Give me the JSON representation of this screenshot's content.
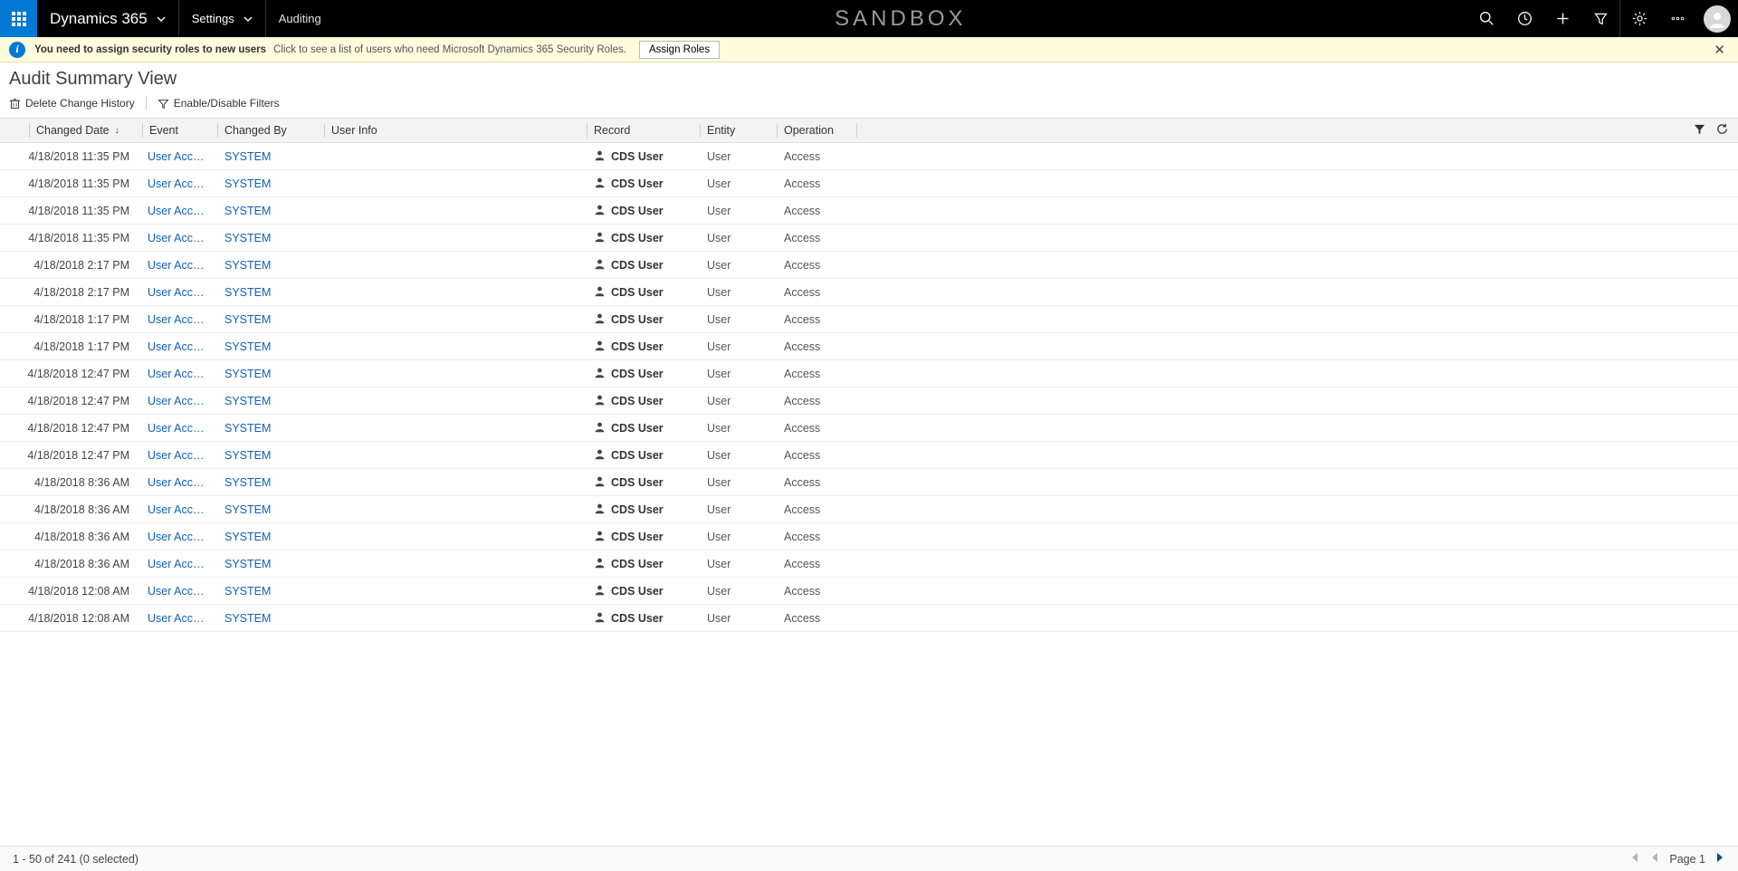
{
  "nav": {
    "brand": "Dynamics 365",
    "area": "Settings",
    "breadcrumb": "Auditing",
    "env_label": "SANDBOX"
  },
  "notif": {
    "bold": "You need to assign security roles to new users",
    "desc": "Click to see a list of users who need Microsoft Dynamics 365 Security Roles.",
    "button": "Assign Roles"
  },
  "page": {
    "title": "Audit Summary View"
  },
  "commands": {
    "delete_history": "Delete Change History",
    "filters": "Enable/Disable Filters"
  },
  "columns": {
    "changed_date": "Changed Date",
    "event": "Event",
    "changed_by": "Changed By",
    "user_info": "User Info",
    "record": "Record",
    "entity": "Entity",
    "operation": "Operation"
  },
  "rows": [
    {
      "date": "4/18/2018 11:35 PM",
      "event": "User Access v...",
      "by": "SYSTEM",
      "record": "CDS User",
      "entity": "User",
      "op": "Access"
    },
    {
      "date": "4/18/2018 11:35 PM",
      "event": "User Access v...",
      "by": "SYSTEM",
      "record": "CDS User",
      "entity": "User",
      "op": "Access"
    },
    {
      "date": "4/18/2018 11:35 PM",
      "event": "User Access v...",
      "by": "SYSTEM",
      "record": "CDS User",
      "entity": "User",
      "op": "Access"
    },
    {
      "date": "4/18/2018 11:35 PM",
      "event": "User Access v...",
      "by": "SYSTEM",
      "record": "CDS User",
      "entity": "User",
      "op": "Access"
    },
    {
      "date": "4/18/2018 2:17 PM",
      "event": "User Access v...",
      "by": "SYSTEM",
      "record": "CDS User",
      "entity": "User",
      "op": "Access"
    },
    {
      "date": "4/18/2018 2:17 PM",
      "event": "User Access v...",
      "by": "SYSTEM",
      "record": "CDS User",
      "entity": "User",
      "op": "Access"
    },
    {
      "date": "4/18/2018 1:17 PM",
      "event": "User Access v...",
      "by": "SYSTEM",
      "record": "CDS User",
      "entity": "User",
      "op": "Access"
    },
    {
      "date": "4/18/2018 1:17 PM",
      "event": "User Access v...",
      "by": "SYSTEM",
      "record": "CDS User",
      "entity": "User",
      "op": "Access"
    },
    {
      "date": "4/18/2018 12:47 PM",
      "event": "User Access v...",
      "by": "SYSTEM",
      "record": "CDS User",
      "entity": "User",
      "op": "Access"
    },
    {
      "date": "4/18/2018 12:47 PM",
      "event": "User Access v...",
      "by": "SYSTEM",
      "record": "CDS User",
      "entity": "User",
      "op": "Access"
    },
    {
      "date": "4/18/2018 12:47 PM",
      "event": "User Access v...",
      "by": "SYSTEM",
      "record": "CDS User",
      "entity": "User",
      "op": "Access"
    },
    {
      "date": "4/18/2018 12:47 PM",
      "event": "User Access v...",
      "by": "SYSTEM",
      "record": "CDS User",
      "entity": "User",
      "op": "Access"
    },
    {
      "date": "4/18/2018 8:36 AM",
      "event": "User Access v...",
      "by": "SYSTEM",
      "record": "CDS User",
      "entity": "User",
      "op": "Access"
    },
    {
      "date": "4/18/2018 8:36 AM",
      "event": "User Access v...",
      "by": "SYSTEM",
      "record": "CDS User",
      "entity": "User",
      "op": "Access"
    },
    {
      "date": "4/18/2018 8:36 AM",
      "event": "User Access v...",
      "by": "SYSTEM",
      "record": "CDS User",
      "entity": "User",
      "op": "Access"
    },
    {
      "date": "4/18/2018 8:36 AM",
      "event": "User Access v...",
      "by": "SYSTEM",
      "record": "CDS User",
      "entity": "User",
      "op": "Access"
    },
    {
      "date": "4/18/2018 12:08 AM",
      "event": "User Access v...",
      "by": "SYSTEM",
      "record": "CDS User",
      "entity": "User",
      "op": "Access"
    },
    {
      "date": "4/18/2018 12:08 AM",
      "event": "User Access v...",
      "by": "SYSTEM",
      "record": "CDS User",
      "entity": "User",
      "op": "Access"
    }
  ],
  "footer": {
    "range": "1 - 50 of 241 (0 selected)",
    "page_label": "Page 1"
  }
}
